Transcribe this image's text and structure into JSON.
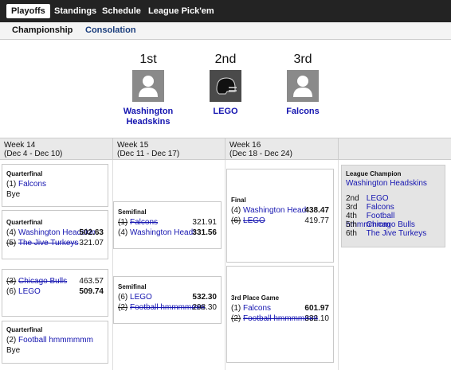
{
  "nav": {
    "tabs": [
      "Playoffs",
      "Standings",
      "Schedule",
      "League Pick'em"
    ],
    "subtabs": [
      "Championship",
      "Consolation"
    ]
  },
  "podium": [
    {
      "place": "1st",
      "team": "Washington Headskins",
      "icon": "person-avatar-icon"
    },
    {
      "place": "2nd",
      "team": "LEGO",
      "icon": "football-helmet-icon"
    },
    {
      "place": "3rd",
      "team": "Falcons",
      "icon": "person-avatar-icon"
    }
  ],
  "weeks": [
    {
      "title": "Week 14",
      "range": "(Dec 4 - Dec 10)"
    },
    {
      "title": "Week 15",
      "range": "(Dec 11 - Dec 17)"
    },
    {
      "title": "Week 16",
      "range": "(Dec 18 - Dec 24)"
    }
  ],
  "matchups": {
    "qf1": {
      "title": "Quarterfinal",
      "a_seed": "(1)",
      "a_name": "Falcons",
      "bye": "Bye"
    },
    "qf2": {
      "title": "Quarterfinal",
      "a_seed": "(4)",
      "a_name": "Washington Headskins",
      "a_score": "502.63",
      "b_seed": "(5)",
      "b_name": "The Jive Turkeys",
      "b_score": "321.07"
    },
    "qf3": {
      "title": "",
      "a_seed": "(3)",
      "a_name": "Chicago Bulls",
      "a_score": "463.57",
      "b_seed": "(6)",
      "b_name": "LEGO",
      "b_score": "509.74"
    },
    "qf4": {
      "title": "Quarterfinal",
      "a_seed": "(2)",
      "a_name": "Football hmmmmmm",
      "bye": "Bye"
    },
    "sf1": {
      "title": "Semifinal",
      "a_seed": "(1)",
      "a_name": "Falcons",
      "a_score": "321.91",
      "b_seed": "(4)",
      "b_name": "Washington Headskins",
      "b_score": "331.56"
    },
    "sf2": {
      "title": "Semifinal",
      "a_seed": "(6)",
      "a_name": "LEGO",
      "a_score": "532.30",
      "b_seed": "(2)",
      "b_name": "Football hmmmmmm",
      "b_score": "298.30"
    },
    "final": {
      "title": "Final",
      "a_seed": "(4)",
      "a_name": "Washington Headskins",
      "a_score": "438.47",
      "b_seed": "(6)",
      "b_name": "LEGO",
      "b_score": "419.77"
    },
    "third": {
      "title": "3rd Place Game",
      "a_seed": "(1)",
      "a_name": "Falcons",
      "a_score": "601.97",
      "b_seed": "(2)",
      "b_name": "Football hmmmmmm",
      "b_score": "332.10"
    }
  },
  "champion": {
    "label": "League Champion",
    "winner": "Washington Headskins",
    "ranks": [
      {
        "rank": "2nd",
        "team": "LEGO"
      },
      {
        "rank": "3rd",
        "team": "Falcons"
      },
      {
        "rank": "4th",
        "team": "Football hmmmmmm"
      },
      {
        "rank": "5th",
        "team": "Chicago Bulls"
      },
      {
        "rank": "6th",
        "team": "The Jive Turkeys"
      }
    ]
  }
}
